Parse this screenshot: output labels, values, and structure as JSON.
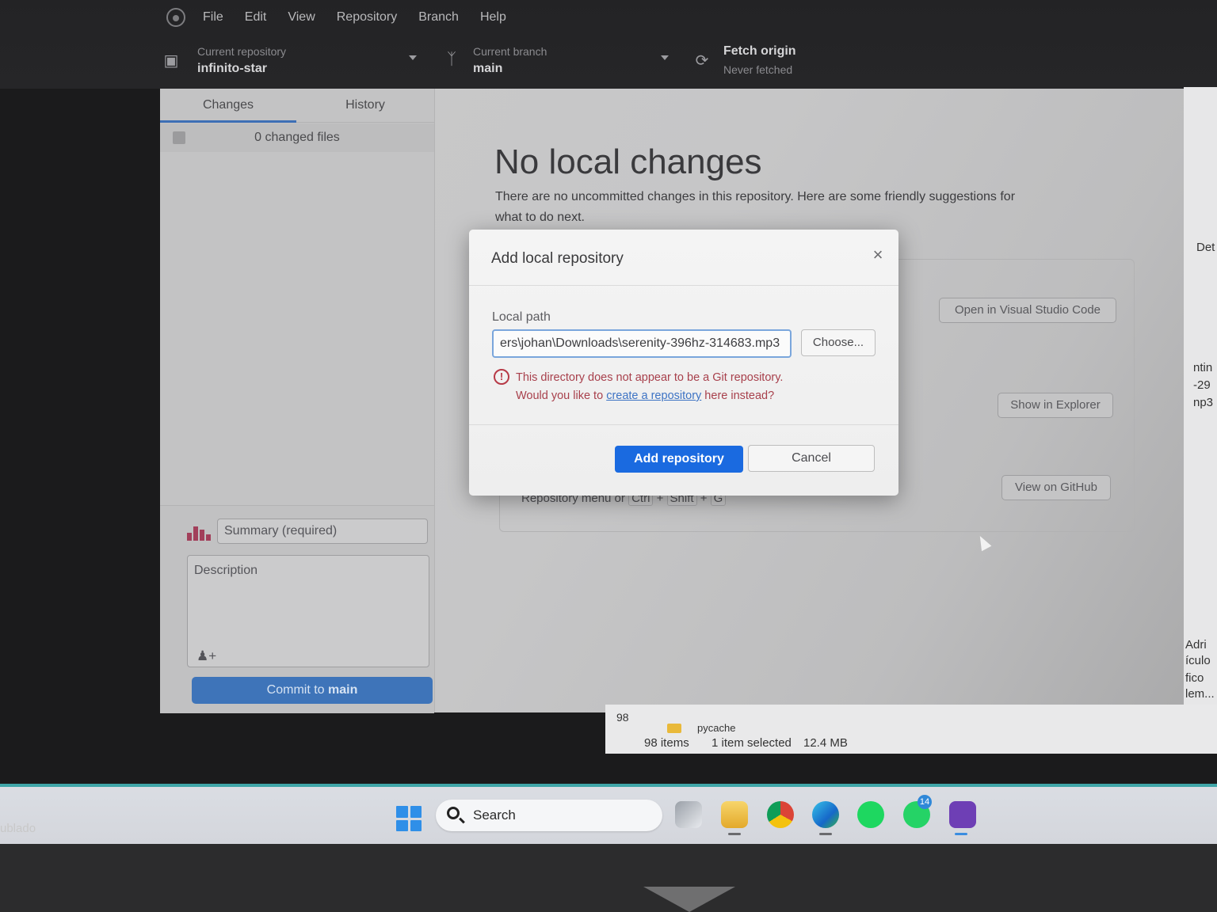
{
  "menubar": {
    "items": [
      "File",
      "Edit",
      "View",
      "Repository",
      "Branch",
      "Help"
    ]
  },
  "toolbar": {
    "repo_label": "Current repository",
    "repo_value": "infinito-star",
    "branch_label": "Current branch",
    "branch_value": "main",
    "fetch_label": "Fetch origin",
    "fetch_value": "Never fetched"
  },
  "sidebar": {
    "tabs": [
      "Changes",
      "History"
    ],
    "changed_files": "0 changed files",
    "summary_placeholder": "Summary (required)",
    "description_placeholder": "Description",
    "commit_prefix": "Commit to ",
    "commit_branch": "main"
  },
  "main": {
    "title": "No local changes",
    "subtitle": "There are no uncommitted changes in this repository. Here are some friendly suggestions for what to do next.",
    "buttons": [
      "Open in Visual Studio Code",
      "Show in Explorer",
      "View on GitHub"
    ],
    "shortcut_text": "Repository menu or",
    "shortcut_keys": [
      "Ctrl",
      "Shift",
      "G"
    ]
  },
  "modal": {
    "title": "Add local repository",
    "field_label": "Local path",
    "path_value": "ers\\johan\\Downloads\\serenity-396hz-314683.mp3",
    "choose_label": "Choose...",
    "warning_line1": "This directory does not appear to be a Git repository.",
    "warning_prefix": "Would you like to ",
    "warning_link": "create a repository",
    "warning_suffix": " here instead?",
    "add_label": "Add repository",
    "cancel_label": "Cancel"
  },
  "background_window": {
    "right_fragments": [
      "Det",
      "ntin",
      "-29",
      "np3",
      "Adri",
      "ículo",
      "fico",
      "lem..."
    ],
    "folder_name": "pycache",
    "partial_count": "98",
    "items_count": "98 items",
    "selected": "1 item selected",
    "size": "12.4 MB"
  },
  "taskbar": {
    "search_label": "Search",
    "whatsapp_badge": "14",
    "left_fragment": "ublado"
  }
}
